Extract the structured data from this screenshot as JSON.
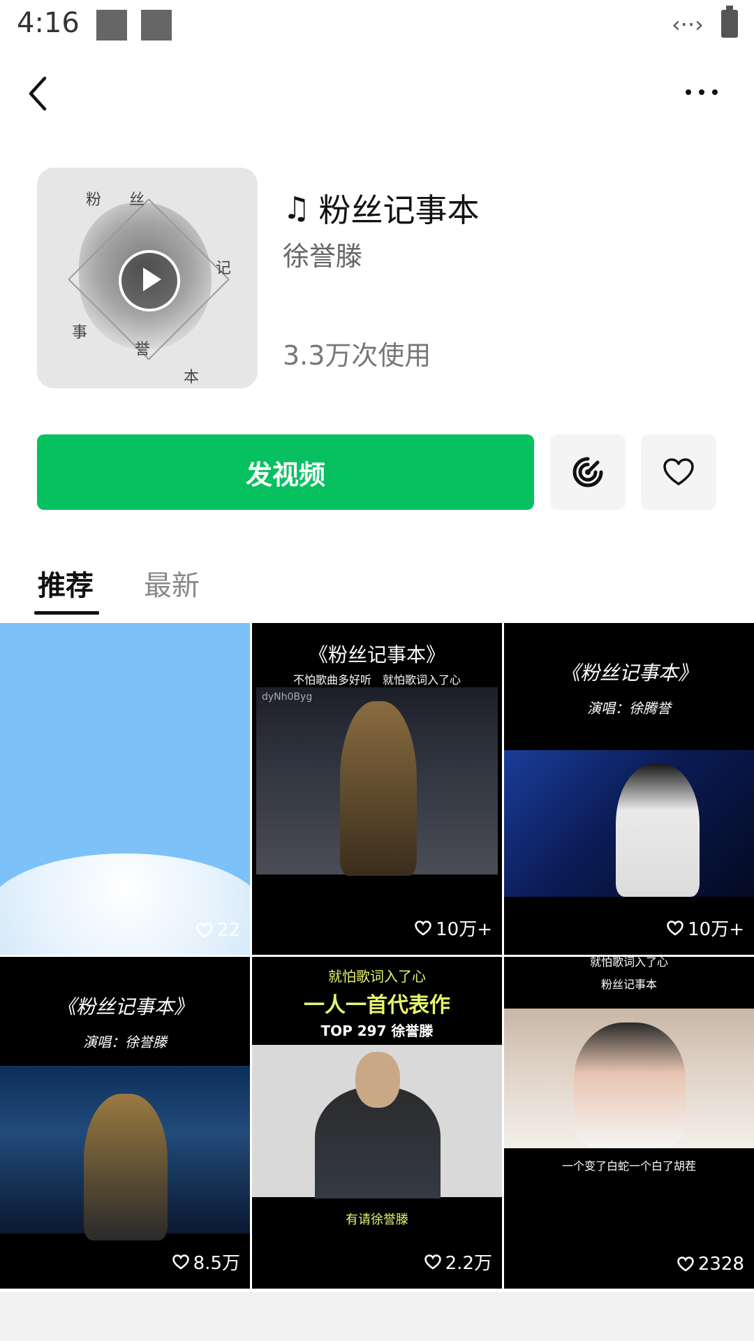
{
  "status": {
    "time": "4:16",
    "network_icon": "data-arrows-icon",
    "battery_icon": "battery-icon"
  },
  "nav": {
    "back_icon": "back-chevron-icon",
    "more_icon": "more-dots-icon"
  },
  "header": {
    "title": "粉丝记事本",
    "artist": "徐誉滕",
    "uses": "3.3万次使用",
    "note_icon": "♫",
    "cover_chars": [
      "粉",
      "丝",
      "记",
      "事",
      "誉",
      "本"
    ]
  },
  "actions": {
    "video_label": "发视频",
    "accent": "#07c160"
  },
  "tabs": [
    {
      "label": "推荐",
      "active": true
    },
    {
      "label": "最新",
      "active": false
    }
  ],
  "grid": [
    {
      "likes": "22"
    },
    {
      "likes": "10万+",
      "title": "《粉丝记事本》",
      "caption": "不怕歌曲多好听　就怕歌词入了心",
      "watermark": "dyNh0Byg"
    },
    {
      "likes": "10万+",
      "title": "《粉丝记事本》",
      "caption": "演唱：徐腾誉"
    },
    {
      "likes": "8.5万",
      "title": "《粉丝记事本》",
      "caption": "演唱：徐誉滕"
    },
    {
      "likes": "2.2万",
      "line1": "就怕歌词入了心",
      "line2": "一人一首代表作",
      "line3": "TOP 297 徐誉滕",
      "bottom_caption": "有请徐誉滕"
    },
    {
      "likes": "2328",
      "line1": "就怕歌词入了心",
      "line2": "粉丝记事本",
      "bottom_caption": "一个变了白蛇一个白了胡茬"
    }
  ]
}
